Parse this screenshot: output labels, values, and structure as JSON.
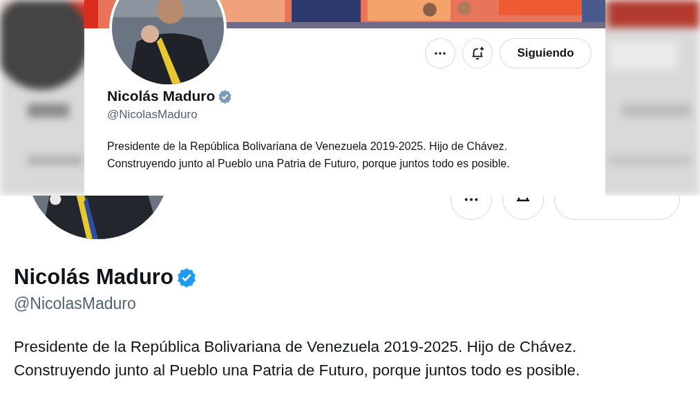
{
  "top_profile": {
    "name": "Nicolás Maduro",
    "verified": true,
    "handle": "@NicolasMaduro",
    "bio": [
      "Presidente de la República Bolivariana de Venezuela 2019-2025. Hijo de Chávez.",
      "Construyendo junto al Pueblo una Patria de Futuro, porque juntos todo es posible."
    ],
    "actions": [
      {
        "kind": "more"
      },
      {
        "kind": "notify"
      },
      {
        "kind": "follow",
        "label": "Siguiendo"
      }
    ]
  },
  "bottom_profile": {
    "name": "Nicolás Maduro",
    "verified": true,
    "handle": "@NicolasMaduro",
    "bio": [
      "Presidente de la República Bolivariana de Venezuela 2019-2025. Hijo de Chávez.",
      "Construyendo junto al Pueblo una Patria de Futuro, porque juntos todo es posible."
    ],
    "actions": [
      {
        "kind": "more"
      },
      {
        "kind": "notify"
      },
      {
        "kind": "follow"
      }
    ]
  }
}
